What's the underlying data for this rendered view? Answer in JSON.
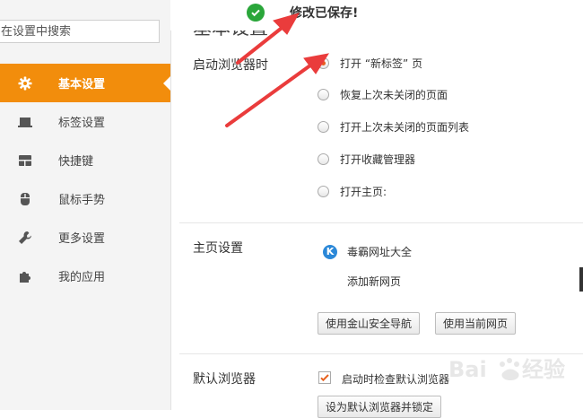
{
  "sidebar": {
    "search_placeholder": "在设置中搜索",
    "items": [
      {
        "label": "基本设置",
        "icon": "gear-icon"
      },
      {
        "label": "标签设置",
        "icon": "tab-icon"
      },
      {
        "label": "快捷键",
        "icon": "keyboard-icon"
      },
      {
        "label": "鼠标手势",
        "icon": "mouse-icon"
      },
      {
        "label": "更多设置",
        "icon": "wrench-icon"
      },
      {
        "label": "我的应用",
        "icon": "puzzle-icon"
      }
    ],
    "active_color": "#f28d0c"
  },
  "toast": {
    "message": "修改已保存!",
    "color": "#2aa63a"
  },
  "main": {
    "heading_partial": "基本设置",
    "startup": {
      "label": "启动浏览器时",
      "options": [
        {
          "label": "打开 “新标签” 页",
          "selected": true
        },
        {
          "label": "恢复上次未关闭的页面",
          "selected": false
        },
        {
          "label": "打开上次未关闭的页面列表",
          "selected": false
        },
        {
          "label": "打开收藏管理器",
          "selected": false
        },
        {
          "label": "打开主页:",
          "selected": false
        }
      ]
    },
    "homepage": {
      "label": "主页设置",
      "item_label": "毒霸网址大全",
      "item_icon": "k-logo-icon",
      "add_new": "添加新网页",
      "btn_safe_nav": "使用金山安全导航",
      "btn_current": "使用当前网页"
    },
    "default_browser": {
      "label": "默认浏览器",
      "check_label": "启动时检查默认浏览器",
      "checked": true,
      "btn_set_default": "设为默认浏览器并锁定"
    }
  },
  "annotation": {
    "arrow_color": "#ea3c3c"
  }
}
